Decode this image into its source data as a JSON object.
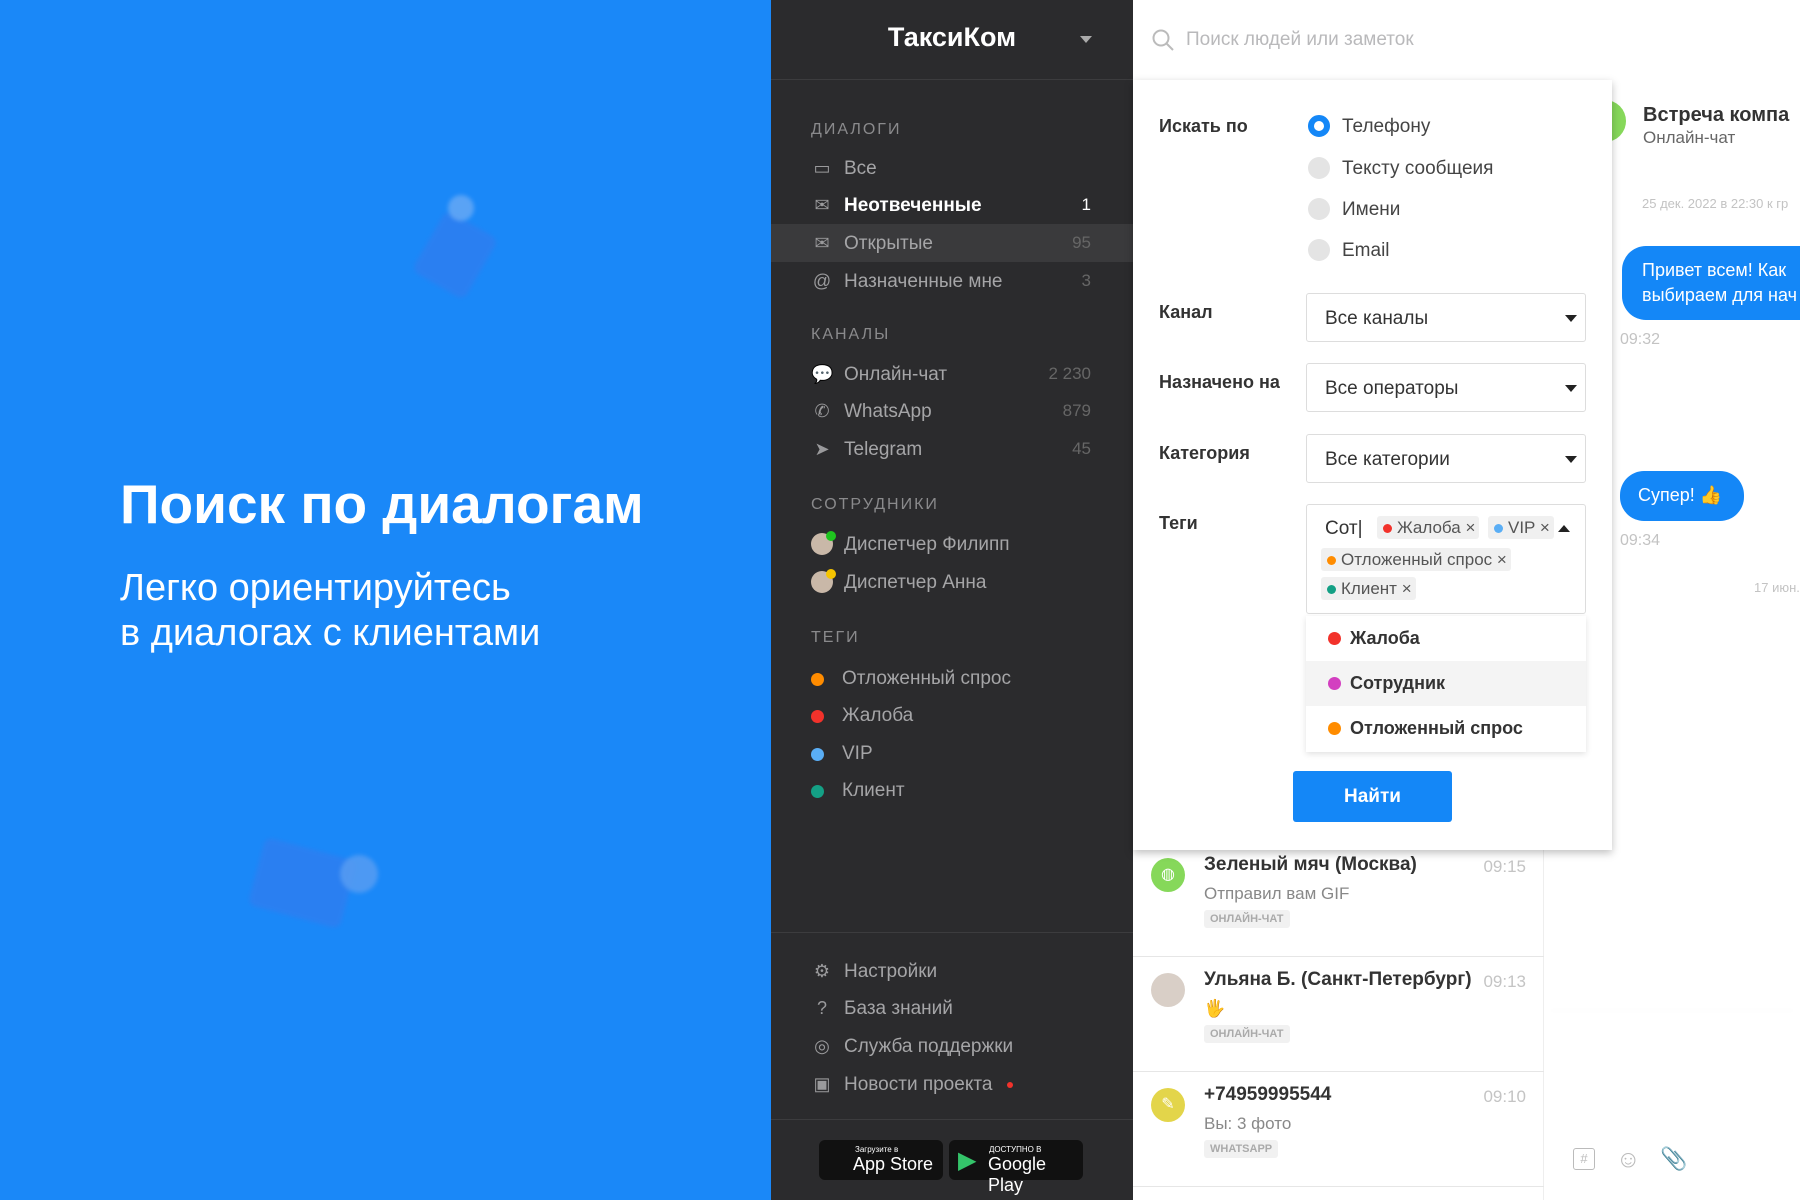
{
  "promo": {
    "title": "Поиск по диалогам",
    "subtitle_line1": "Легко ориентируйтесь",
    "subtitle_line2": "в диалогах с клиентами",
    "bg_color": "#1a88f8"
  },
  "sidebar": {
    "workspace": "ТаксиКом",
    "sections": {
      "dialogs": {
        "label": "ДИАЛОГИ",
        "items": [
          {
            "label": "Все",
            "count": "",
            "icon": "inbox-icon"
          },
          {
            "label": "Неотвеченные",
            "count": "1",
            "icon": "envelope-icon"
          },
          {
            "label": "Открытые",
            "count": "95",
            "icon": "open-envelope-icon"
          },
          {
            "label": "Назначенные мне",
            "count": "3",
            "icon": "at-icon"
          }
        ]
      },
      "channels": {
        "label": "КАНАЛЫ",
        "items": [
          {
            "label": "Онлайн-чат",
            "count": "2 230",
            "icon": "chat-bubbles-icon"
          },
          {
            "label": "WhatsApp",
            "count": "879",
            "icon": "whatsapp-icon"
          },
          {
            "label": "Telegram",
            "count": "45",
            "icon": "telegram-icon"
          }
        ]
      },
      "staff": {
        "label": "СОТРУДНИКИ",
        "items": [
          {
            "label": "Диспетчер Филипп",
            "status_color": "#1fc41f"
          },
          {
            "label": "Диспетчер Анна",
            "status_color": "#f5c400"
          }
        ]
      },
      "tags": {
        "label": "ТЕГИ",
        "items": [
          {
            "label": "Отложенный спрос",
            "color": "#ff8c00"
          },
          {
            "label": "Жалоба",
            "color": "#f2322b"
          },
          {
            "label": "VIP",
            "color": "#5aaef5"
          },
          {
            "label": "Клиент",
            "color": "#14a085"
          }
        ]
      }
    },
    "footer": [
      {
        "label": "Настройки",
        "icon": "gear-icon"
      },
      {
        "label": "База знаний",
        "icon": "question-icon"
      },
      {
        "label": "Служба поддержки",
        "icon": "lifebuoy-icon"
      },
      {
        "label": "Новости проекта",
        "icon": "news-icon"
      }
    ],
    "stores": {
      "appstore_small": "Загрузите в",
      "appstore": "App Store",
      "google_small": "ДОСТУПНО В",
      "google": "Google Play"
    }
  },
  "search": {
    "placeholder": "Поиск людей или заметок"
  },
  "filter": {
    "search_by_label": "Искать по",
    "search_by_options": [
      "Телефону",
      "Тексту сообщеия",
      "Имени",
      "Email"
    ],
    "search_by_selected": "Телефону",
    "channel_label": "Канал",
    "channel_value": "Все каналы",
    "assigned_label": "Назначено на",
    "assigned_value": "Все операторы",
    "category_label": "Категория",
    "category_value": "Все категории",
    "tags_label": "Теги",
    "tags_input": "Сот|",
    "selected_tags": [
      {
        "label": "Жалоба",
        "color": "#f2322b"
      },
      {
        "label": "VIP",
        "color": "#5aaef5"
      },
      {
        "label": "Отложенный спрос",
        "color": "#ff8c00"
      },
      {
        "label": "Клиент",
        "color": "#14a085"
      }
    ],
    "remove_glyph": "×",
    "dropdown": [
      {
        "label": "Жалоба",
        "color": "#f2322b"
      },
      {
        "label": "Сотрудник",
        "color": "#d33fc0"
      },
      {
        "label": "Отложенный спрос",
        "color": "#ff8c00"
      }
    ],
    "submit": "Найти"
  },
  "chats": [
    {
      "name": "Зеленый мяч (Москва)",
      "time": "09:15",
      "preview": "Отправил вам GIF",
      "channel": "ОНЛАЙН-ЧАТ",
      "avatar_color": "#86d85a"
    },
    {
      "name": "Ульяна Б. (Санкт-Петербург)",
      "time": "09:13",
      "preview": "🖐",
      "channel": "ОНЛАЙН-ЧАТ",
      "avatar_color": "#d9cfc7"
    },
    {
      "name": "+74959995544",
      "time": "09:10",
      "preview": "Вы: 3 фото",
      "channel": "WHATSAPP",
      "avatar_color": "#e3d54a"
    }
  ],
  "conversation": {
    "title": "Встреча компа",
    "channel": "Онлайн-чат",
    "event": "25 дек. 2022 в 22:30 к гр",
    "messages": [
      {
        "text_line1": "Привет всем! Как",
        "text_line2": "выбираем для нач",
        "time": "09:32"
      },
      {
        "text": "Супер! 👍",
        "time": "09:34"
      }
    ],
    "date_divider": "17 июн."
  },
  "accent_color": "#1487f7"
}
